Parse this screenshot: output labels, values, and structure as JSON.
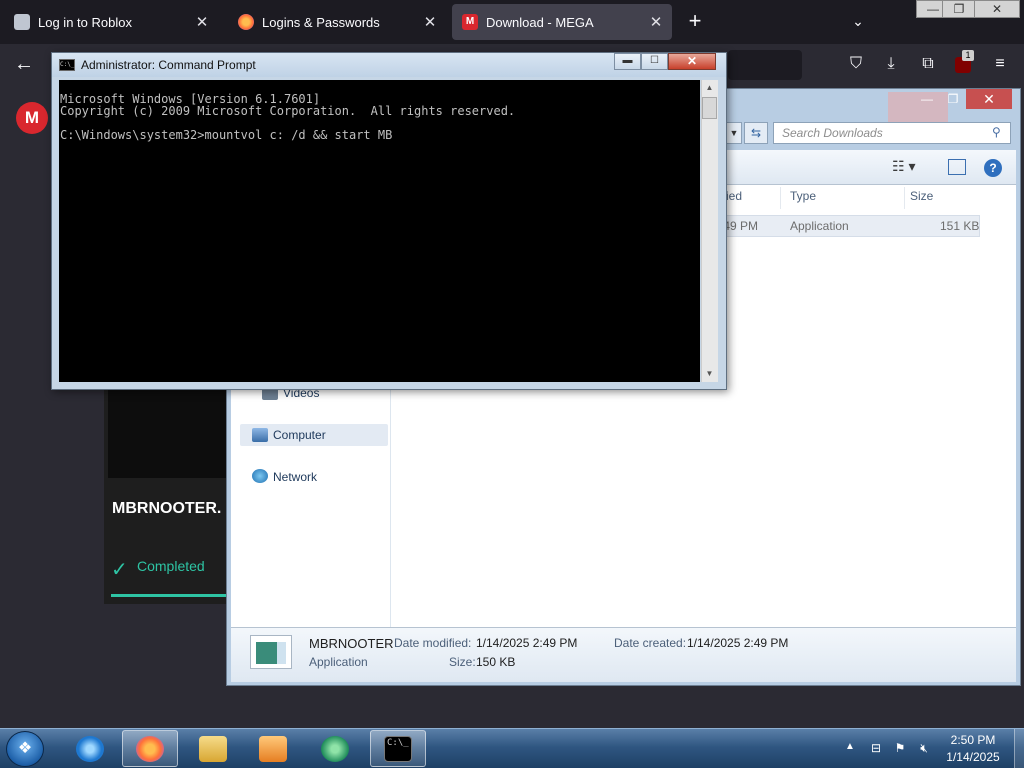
{
  "browser": {
    "tabs": [
      {
        "label": "Log in to Roblox",
        "close": "✕"
      },
      {
        "label": "Logins & Passwords",
        "close": "✕"
      },
      {
        "label": "Download - MEGA",
        "close": "✕"
      }
    ],
    "new_tab": "+",
    "tab_list": "⌄",
    "window_controls": {
      "minimize": "—",
      "restore": "❐",
      "close": "✕"
    },
    "back": "←",
    "badge_count": "1",
    "tools": {
      "pocket": "⛉",
      "downloads": "⤓",
      "extensions": "⧉",
      "menu": "≡"
    }
  },
  "mega": {
    "logo": "M",
    "filename": "MBRNOOTER.",
    "status": "Completed",
    "check": "✓",
    "progress": 1.0,
    "accent": "#2ec4a4"
  },
  "explorer": {
    "search_placeholder": "Search Downloads",
    "columns": [
      "ified",
      "Type",
      "Size"
    ],
    "file_row": {
      "modified": ":49 PM",
      "type": "Application",
      "size": "151 KB"
    },
    "nav": [
      {
        "label": "Videos"
      },
      {
        "label": "Computer"
      },
      {
        "label": "Network"
      }
    ],
    "details": {
      "name": "MBRNOOTER",
      "kind": "Application",
      "modified_label": "Date modified:",
      "modified_value": "1/14/2025 2:49 PM",
      "size_label": "Size:",
      "size_value": "150 KB",
      "created_label": "Date created:",
      "created_value": "1/14/2025 2:49 PM"
    },
    "help": "?"
  },
  "cmd": {
    "title": "Administrator: Command Prompt",
    "icon_text": "C:\\_",
    "lines": [
      "Microsoft Windows [Version 6.1.7601]",
      "Copyright (c) 2009 Microsoft Corporation.  All rights reserved.",
      "",
      "C:\\Windows\\system32>mountvol c: /d && start MB"
    ]
  },
  "taskbar": {
    "time": "2:50 PM",
    "date": "1/14/2025",
    "tray_chevron": "▲",
    "cmd_icon_text": "C:\\_"
  }
}
